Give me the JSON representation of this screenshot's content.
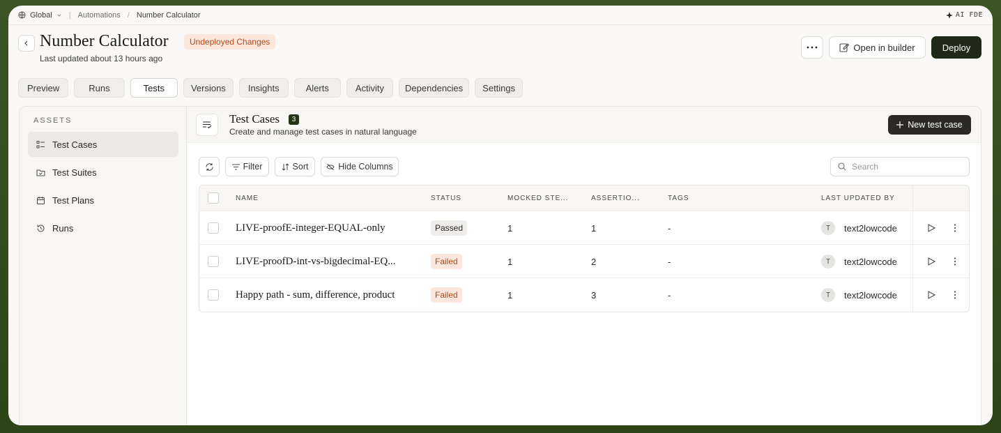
{
  "breadcrumb": {
    "workspace": "Global",
    "section": "Automations",
    "page": "Number Calculator",
    "ai_label": "AI FDE"
  },
  "header": {
    "title": "Number Calculator",
    "badge": "Undeployed Changes",
    "subtitle": "Last updated about 13 hours ago",
    "open_builder_label": "Open in builder",
    "deploy_label": "Deploy"
  },
  "tabs": [
    {
      "label": "Preview"
    },
    {
      "label": "Runs"
    },
    {
      "label": "Tests",
      "active": true
    },
    {
      "label": "Versions"
    },
    {
      "label": "Insights"
    },
    {
      "label": "Alerts"
    },
    {
      "label": "Activity"
    },
    {
      "label": "Dependencies"
    },
    {
      "label": "Settings"
    }
  ],
  "sidebar": {
    "heading": "ASSETS",
    "items": [
      {
        "label": "Test Cases",
        "icon": "list-check-icon",
        "active": true
      },
      {
        "label": "Test Suites",
        "icon": "folder-check-icon"
      },
      {
        "label": "Test Plans",
        "icon": "calendar-icon"
      },
      {
        "label": "Runs",
        "icon": "history-icon"
      }
    ]
  },
  "content": {
    "title": "Test Cases",
    "count": "3",
    "subtitle": "Create and manage test cases in natural language",
    "new_button": "New test case"
  },
  "toolbar": {
    "filter": "Filter",
    "sort": "Sort",
    "hide_columns": "Hide Columns",
    "search_placeholder": "Search"
  },
  "table": {
    "columns": [
      "NAME",
      "STATUS",
      "MOCKED STE...",
      "ASSERTIO...",
      "TAGS",
      "LAST UPDATED BY"
    ],
    "rows": [
      {
        "name": "LIVE-proofE-integer-EQUAL-only",
        "status": "Passed",
        "mocked": "1",
        "assertions": "1",
        "tags": "-",
        "avatar": "T",
        "user": "text2lowcode"
      },
      {
        "name": "LIVE-proofD-int-vs-bigdecimal-EQ...",
        "status": "Failed",
        "mocked": "1",
        "assertions": "2",
        "tags": "-",
        "avatar": "T",
        "user": "text2lowcode"
      },
      {
        "name": "Happy path - sum, difference, product",
        "status": "Failed",
        "mocked": "1",
        "assertions": "3",
        "tags": "-",
        "avatar": "T",
        "user": "text2lowcode"
      }
    ]
  },
  "colors": {
    "accent_dark": "#1f2a18",
    "failed": "#b04a1c",
    "badge_bg": "#fbe7dc"
  }
}
